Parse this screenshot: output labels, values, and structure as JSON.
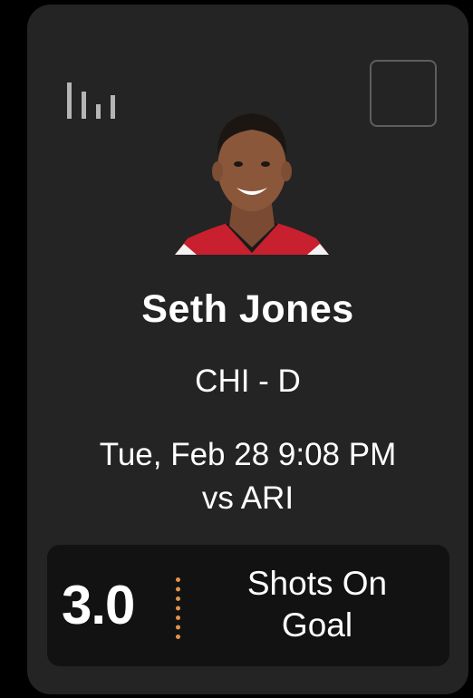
{
  "player": {
    "name": "Seth Jones",
    "team_position": "CHI - D",
    "game_time": "Tue, Feb 28 9:08 PM",
    "opponent": "vs ARI"
  },
  "projection": {
    "line": "3.0",
    "stat_type": "Shots On Goal"
  },
  "icons": {
    "stats": "bar-chart-icon",
    "select": "empty-checkbox"
  },
  "colors": {
    "card_background": "#242424",
    "line_box_background": "#121212",
    "divider_accent": "#e0954a"
  }
}
